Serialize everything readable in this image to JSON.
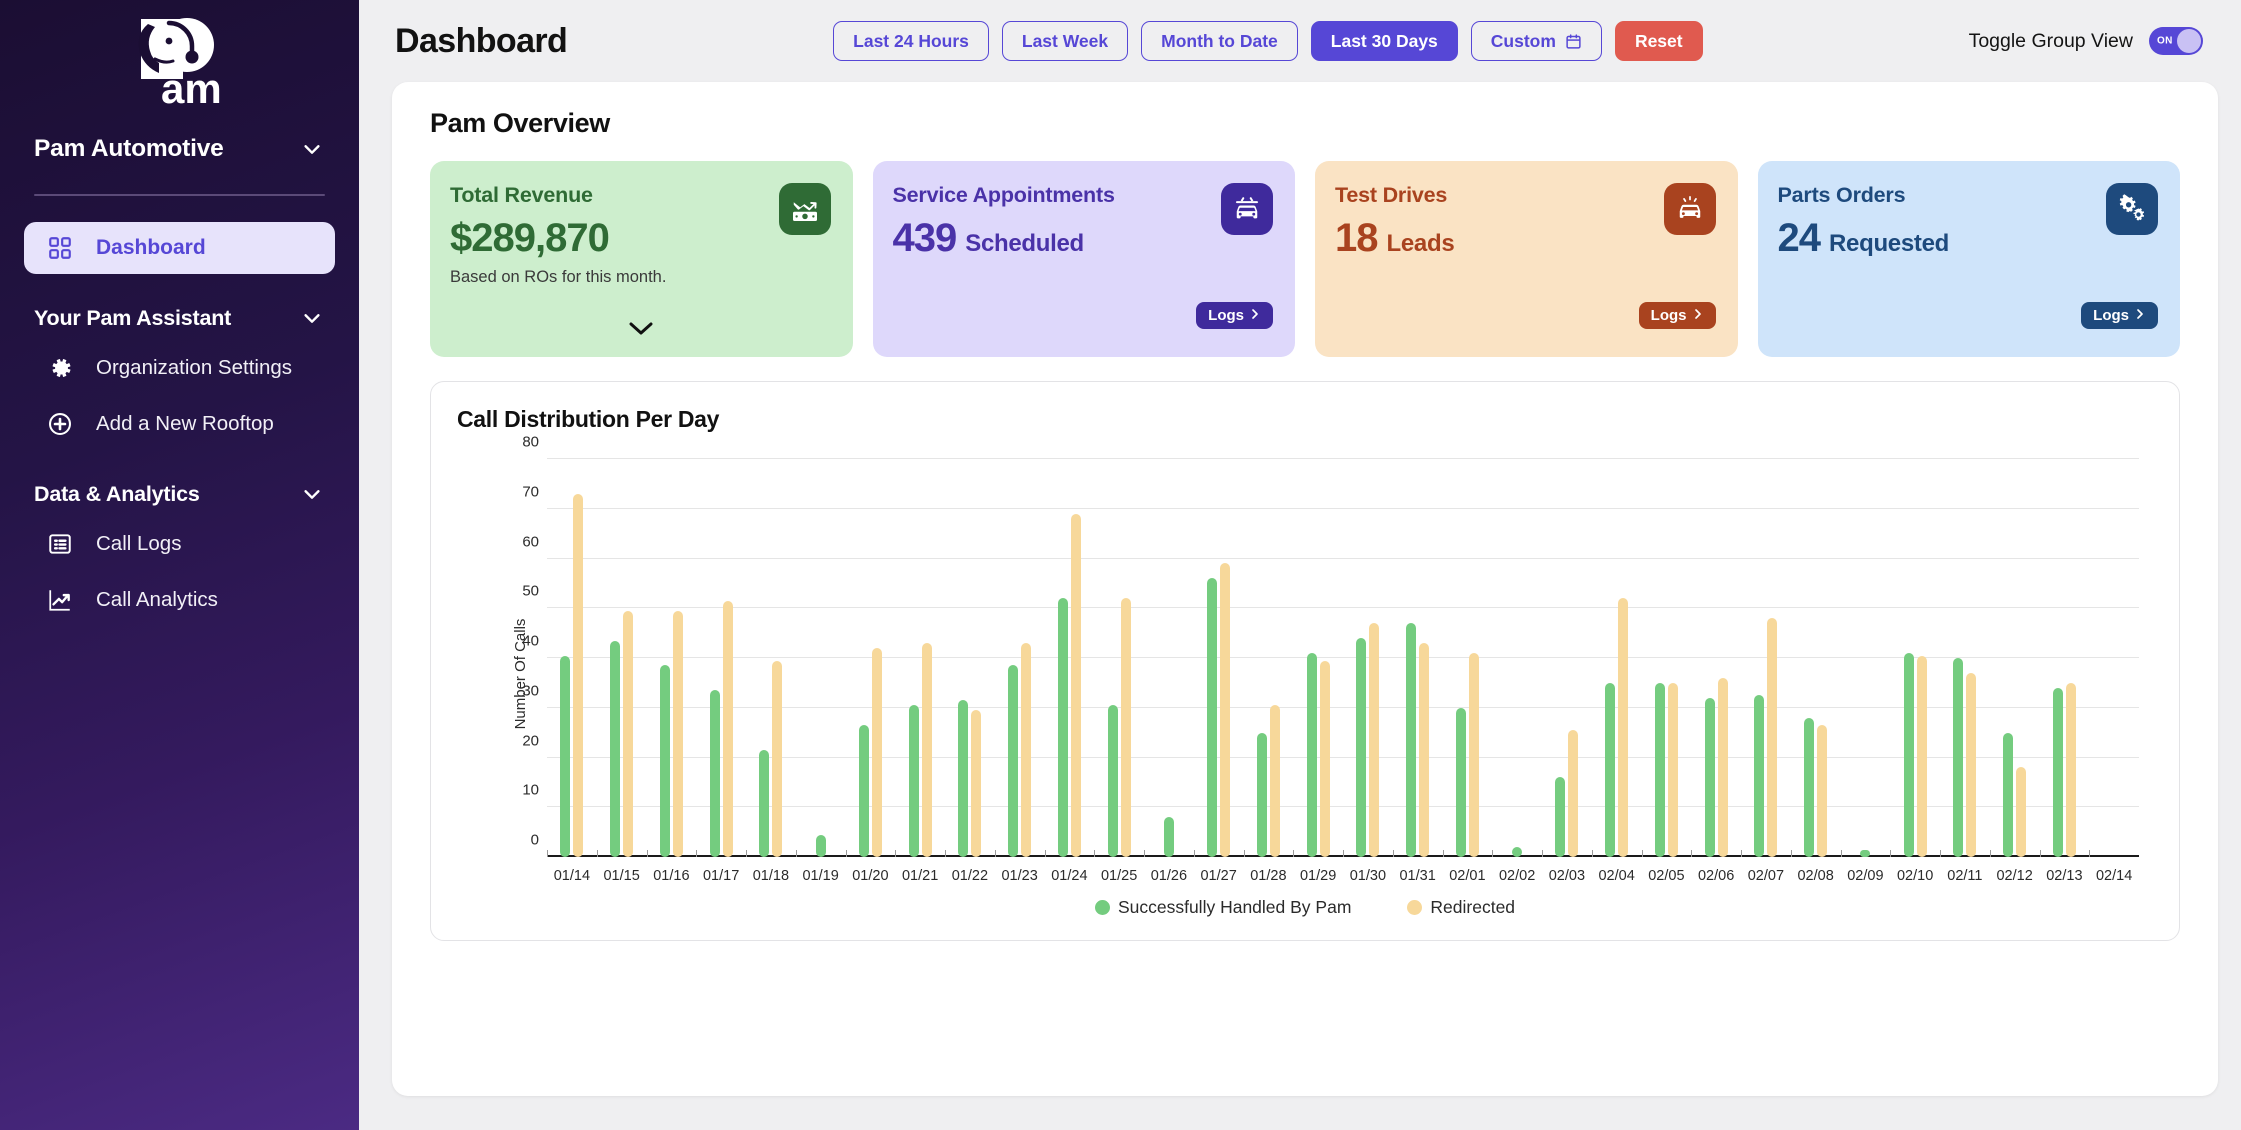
{
  "sidebar": {
    "logo_name": "pam-logo",
    "org_name": "Pam Automotive",
    "org_chevron": "chevron-down-icon",
    "nav": [
      {
        "label": "Dashboard",
        "icon": "dashboard-grid-icon",
        "active": true
      }
    ],
    "sections": [
      {
        "label": "Your Pam Assistant",
        "chevron": "chevron-down-icon",
        "items": [
          {
            "label": "Organization Settings",
            "icon": "gear-icon"
          },
          {
            "label": "Add a New Rooftop",
            "icon": "plus-circle-icon"
          }
        ]
      },
      {
        "label": "Data & Analytics",
        "chevron": "chevron-down-icon",
        "items": [
          {
            "label": "Call Logs",
            "icon": "list-icon"
          },
          {
            "label": "Call Analytics",
            "icon": "trend-chart-icon"
          }
        ]
      }
    ]
  },
  "header": {
    "title": "Dashboard",
    "range_buttons": [
      {
        "label": "Last 24 Hours",
        "style": "outline"
      },
      {
        "label": "Last Week",
        "style": "outline"
      },
      {
        "label": "Month to Date",
        "style": "outline"
      },
      {
        "label": "Last 30 Days",
        "style": "filled"
      },
      {
        "label": "Custom",
        "style": "outline",
        "icon": "calendar-icon"
      },
      {
        "label": "Reset",
        "style": "danger"
      }
    ],
    "toggle_label": "Toggle Group View",
    "toggle_state": "ON"
  },
  "overview": {
    "title": "Pam Overview",
    "cards": [
      {
        "title": "Total Revenue",
        "value": "$289,870",
        "unit": "",
        "subtitle": "Based on ROs for this month.",
        "icon": "money-trend-icon",
        "has_logs": false,
        "has_expand": true,
        "bg": "#cdeecd",
        "fg": "#2f6b35",
        "icon_bg": "#2f6b35"
      },
      {
        "title": "Service Appointments",
        "value": "439",
        "unit": "Scheduled",
        "subtitle": "",
        "icon": "car-service-icon",
        "has_logs": true,
        "logs_label": "Logs",
        "has_expand": false,
        "bg": "#ded8fb",
        "fg": "#4a32a8",
        "icon_bg": "#3f2a9c"
      },
      {
        "title": "Test Drives",
        "value": "18",
        "unit": "Leads",
        "subtitle": "",
        "icon": "car-alert-icon",
        "has_logs": true,
        "logs_label": "Logs",
        "has_expand": false,
        "bg": "#fae3c4",
        "fg": "#a9431f",
        "icon_bg": "#a9431f"
      },
      {
        "title": "Parts Orders",
        "value": "24",
        "unit": "Requested",
        "subtitle": "",
        "icon": "gears-icon",
        "has_logs": true,
        "logs_label": "Logs",
        "has_expand": false,
        "bg": "#cfe4fa",
        "fg": "#1e4a7d",
        "icon_bg": "#1e4a7d"
      }
    ]
  },
  "chart_data": {
    "type": "bar",
    "title": "Call Distribution Per Day",
    "xlabel": "",
    "ylabel": "Number Of Calls",
    "ylim": [
      0,
      80
    ],
    "yticks": [
      0,
      10,
      20,
      30,
      40,
      50,
      60,
      70,
      80
    ],
    "grid": true,
    "legend_position": "bottom",
    "colors": {
      "Successfully Handled By Pam": "#74cc7f",
      "Redirected": "#f7d89a"
    },
    "categories": [
      "01/14",
      "01/15",
      "01/16",
      "01/17",
      "01/18",
      "01/19",
      "01/20",
      "01/21",
      "01/22",
      "01/23",
      "01/24",
      "01/25",
      "01/26",
      "01/27",
      "01/28",
      "01/29",
      "01/30",
      "01/31",
      "02/01",
      "02/02",
      "02/03",
      "02/04",
      "02/05",
      "02/06",
      "02/07",
      "02/08",
      "02/09",
      "02/10",
      "02/11",
      "02/12",
      "02/13",
      "02/14"
    ],
    "series": [
      {
        "name": "Successfully Handled By Pam",
        "values": [
          40.5,
          43.5,
          38.5,
          33.5,
          21.5,
          4.5,
          26.5,
          30.5,
          31.5,
          38.5,
          52,
          30.5,
          8,
          56,
          25,
          41,
          44,
          47,
          30,
          2,
          16,
          35,
          35,
          32,
          32.5,
          28,
          1.5,
          41,
          40,
          25,
          34,
          0
        ]
      },
      {
        "name": "Redirected",
        "values": [
          73,
          49.5,
          49.5,
          51.5,
          39.5,
          0,
          42,
          43,
          29.5,
          43,
          69,
          52,
          0,
          59,
          30.5,
          39.5,
          47,
          43,
          41,
          0,
          25.5,
          52,
          35,
          36,
          48,
          26.5,
          0,
          40.5,
          37,
          18,
          35,
          0
        ]
      }
    ],
    "legend": [
      "Successfully Handled By Pam",
      "Redirected"
    ]
  }
}
